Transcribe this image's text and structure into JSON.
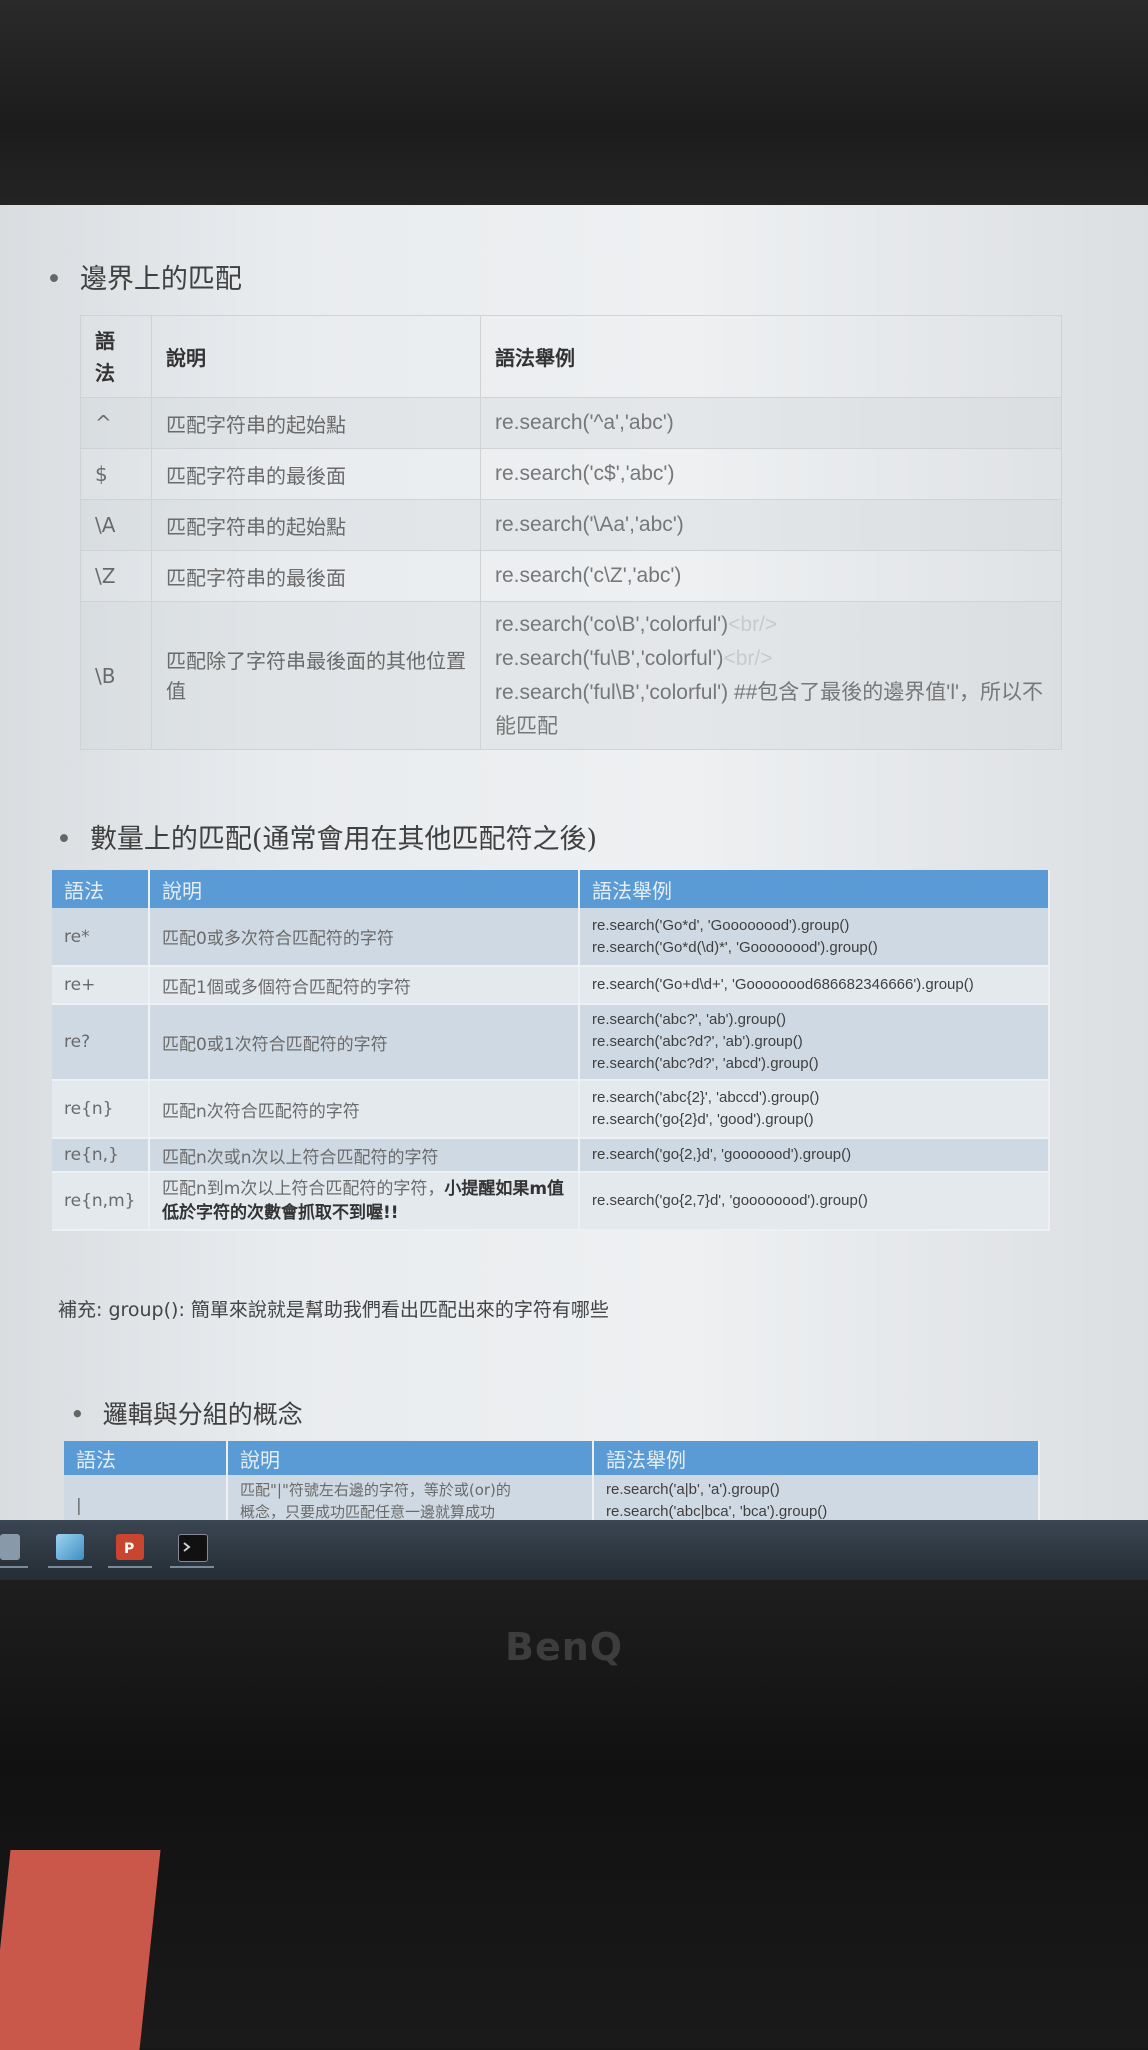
{
  "section1": {
    "title": "邊界上的匹配",
    "headers": [
      "語法",
      "說明",
      "語法舉例"
    ],
    "rows": [
      {
        "syntax": "^",
        "desc": "匹配字符串的起始點",
        "examples": [
          "re.search('^a','abc')"
        ]
      },
      {
        "syntax": "$",
        "desc": "匹配字符串的最後面",
        "examples": [
          "re.search('c$','abc')"
        ]
      },
      {
        "syntax": "\\A",
        "desc": "匹配字符串的起始點",
        "examples": [
          "re.search('\\Aa','abc')"
        ]
      },
      {
        "syntax": "\\Z",
        "desc": "匹配字符串的最後面",
        "examples": [
          "re.search('c\\Z','abc')"
        ]
      },
      {
        "syntax": "\\B",
        "desc": "匹配除了字符串最後面的其他位置值",
        "examples": [
          "re.search('co\\B','colorful')",
          "re.search('fu\\B','colorful')",
          "re.search('ful\\B','colorful') ##包含了最後的邊界值'l'，所以不能匹配"
        ],
        "br_tag": "<br/>"
      }
    ]
  },
  "section2": {
    "title": "數量上的匹配(通常會用在其他匹配符之後)",
    "headers": [
      "語法",
      "說明",
      "語法舉例"
    ],
    "rows": [
      {
        "syntax": "re*",
        "desc": "匹配0或多次符合匹配符的字符",
        "examples": [
          "re.search('Go*d', 'Goooooood').group()",
          "re.search('Go*d(\\d)*', 'Goooooood').group()"
        ]
      },
      {
        "syntax": "re+",
        "desc": "匹配1個或多個符合匹配符的字符",
        "examples": [
          "re.search('Go+d\\d+', 'Goooooood686682346666').group()"
        ]
      },
      {
        "syntax": "re?",
        "desc": "匹配0或1次符合匹配符的字符",
        "examples": [
          "re.search('abc?', 'ab').group()",
          "re.search('abc?d?', 'ab').group()",
          "re.search('abc?d?', 'abcd').group()"
        ]
      },
      {
        "syntax": "re{n}",
        "desc": "匹配n次符合匹配符的字符",
        "examples": [
          "re.search('abc{2}', 'abccd').group()",
          "re.search('go{2}d', 'good').group()"
        ]
      },
      {
        "syntax": "re{n,}",
        "desc": "匹配n次或n次以上符合匹配符的字符",
        "examples": [
          "re.search('go{2,}d', 'gooooood').group()"
        ]
      },
      {
        "syntax": "re{n,m}",
        "desc": "匹配n到m次以上符合匹配符的字符，",
        "warn": "小提醒如果m值低於字符的次數會抓取不到喔!!",
        "examples": [
          "re.search('go{2,7}d', 'goooooood').group()"
        ]
      }
    ]
  },
  "note": "補充: group(): 簡單來說就是幫助我們看出匹配出來的字符有哪些",
  "section3": {
    "title": "邏輯與分組的概念",
    "headers": [
      "語法",
      "說明",
      "語法舉例"
    ],
    "rows": [
      {
        "syntax": "|",
        "desc": [
          "匹配\"|\"符號左右邊的字符，等於或(or)的",
          "概念，只要成功匹配任意一邊就算成功"
        ],
        "examples": [
          "re.search('a|b', 'a').group()",
          "re.search('abc|bca', 'bca').group()"
        ]
      }
    ]
  },
  "monitor": {
    "brand": "BenQ"
  },
  "colors": {
    "table_header": "#5b9bd5",
    "screen_bg": "#eef0f2"
  }
}
